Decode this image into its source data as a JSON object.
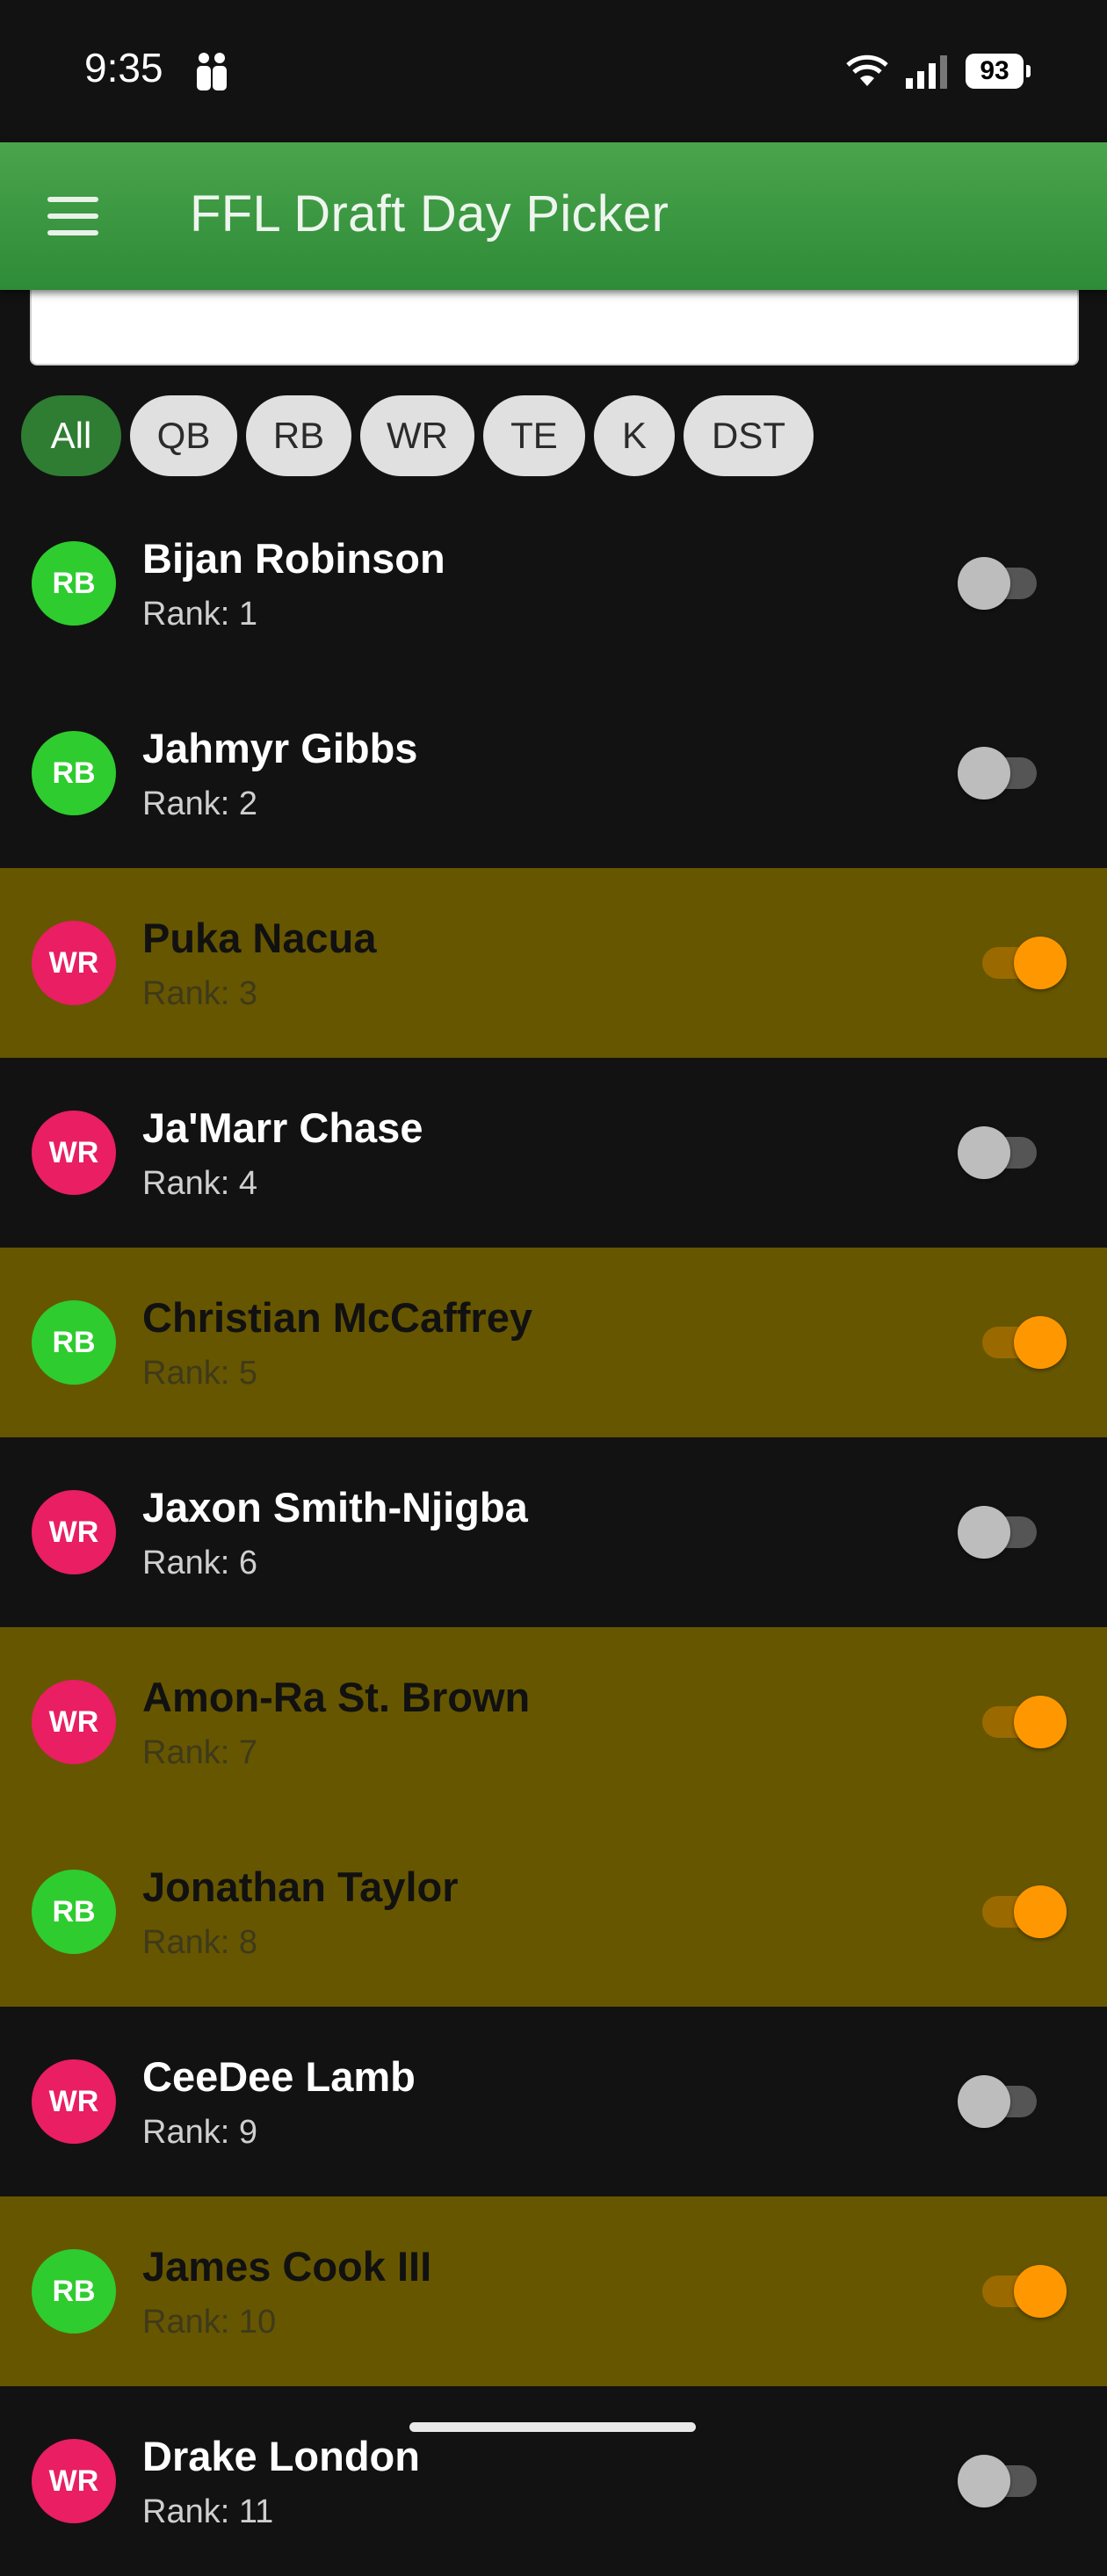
{
  "status_bar": {
    "time": "9:35",
    "battery": "93"
  },
  "app_bar": {
    "title": "FFL Draft Day Picker"
  },
  "search": {
    "value": ""
  },
  "filters": {
    "chips": [
      "All",
      "QB",
      "RB",
      "WR",
      "TE",
      "K",
      "DST"
    ],
    "selected": "All"
  },
  "players": [
    {
      "position": "RB",
      "name": "Bijan Robinson",
      "rank": "Rank: 1",
      "drafted": false
    },
    {
      "position": "RB",
      "name": "Jahmyr Gibbs",
      "rank": "Rank: 2",
      "drafted": false
    },
    {
      "position": "WR",
      "name": "Puka Nacua",
      "rank": "Rank: 3",
      "drafted": true
    },
    {
      "position": "WR",
      "name": "Ja'Marr Chase",
      "rank": "Rank: 4",
      "drafted": false
    },
    {
      "position": "RB",
      "name": "Christian McCaffrey",
      "rank": "Rank: 5",
      "drafted": true
    },
    {
      "position": "WR",
      "name": "Jaxon Smith-Njigba",
      "rank": "Rank: 6",
      "drafted": false
    },
    {
      "position": "WR",
      "name": "Amon-Ra St. Brown",
      "rank": "Rank: 7",
      "drafted": true
    },
    {
      "position": "RB",
      "name": "Jonathan Taylor",
      "rank": "Rank: 8",
      "drafted": true
    },
    {
      "position": "WR",
      "name": "CeeDee Lamb",
      "rank": "Rank: 9",
      "drafted": false
    },
    {
      "position": "RB",
      "name": "James Cook III",
      "rank": "Rank: 10",
      "drafted": true
    },
    {
      "position": "WR",
      "name": "Drake London",
      "rank": "Rank: 11",
      "drafted": false
    }
  ],
  "colors": {
    "app_bar": "#3d9a40",
    "drafted_row": "#665600",
    "rb_badge": "#2ecc2e",
    "wr_badge": "#e91e63",
    "toggle_on": "#ff9800",
    "selected_chip": "#2e7d32"
  }
}
